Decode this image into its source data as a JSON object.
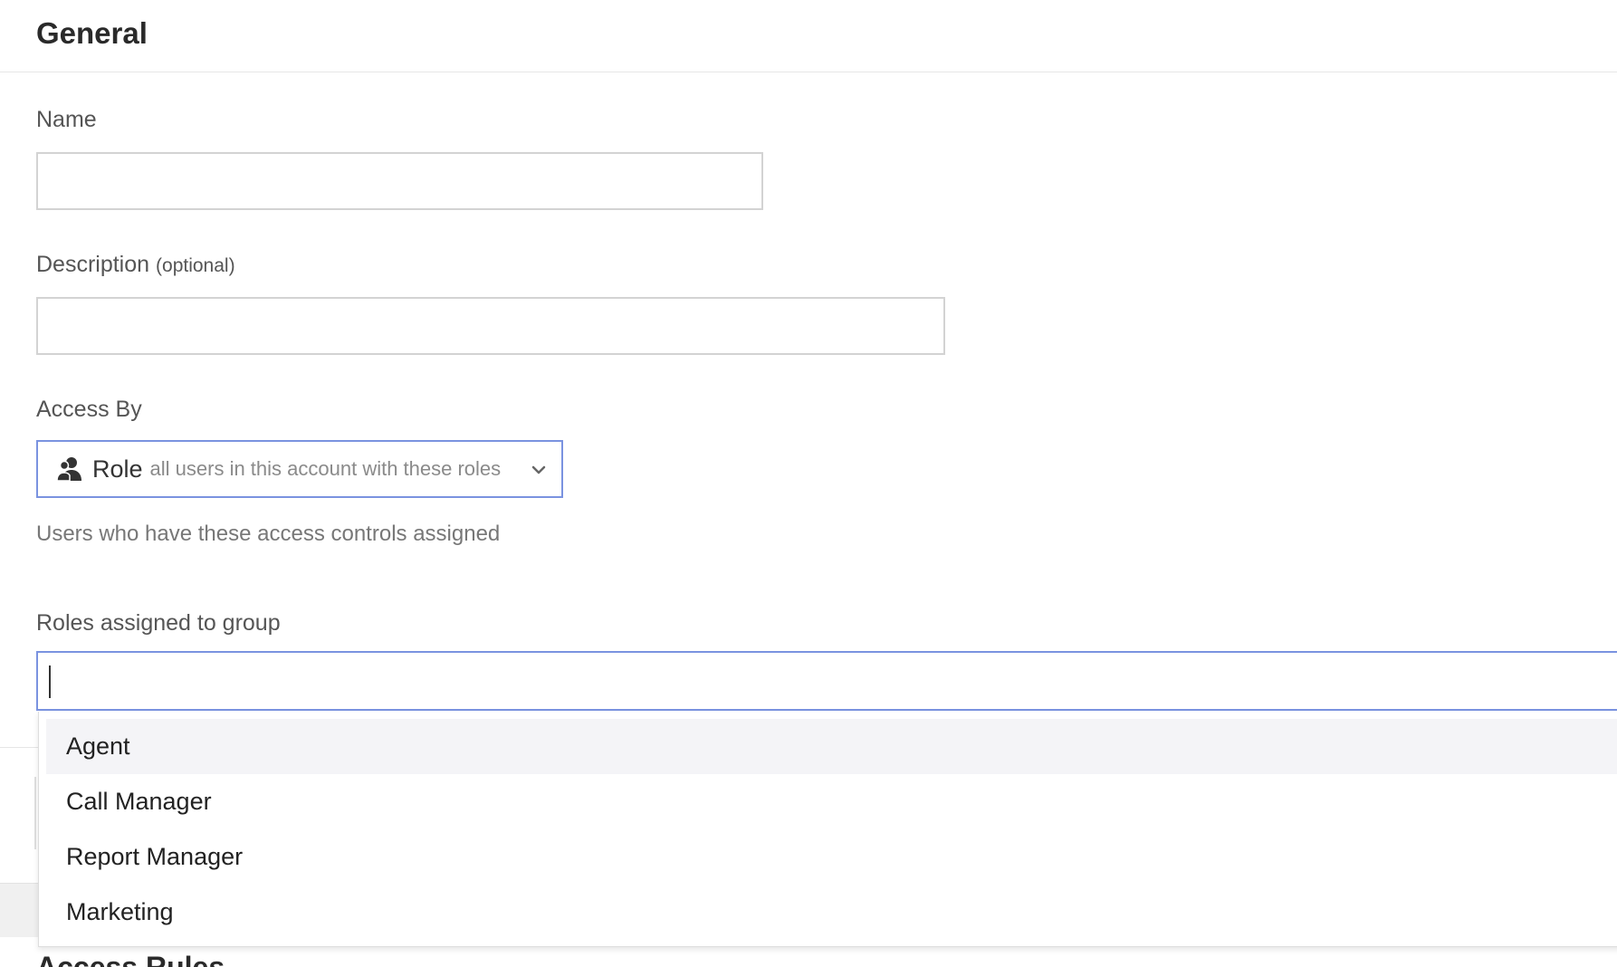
{
  "section": {
    "title": "General"
  },
  "name_field": {
    "label": "Name",
    "value": "",
    "placeholder": ""
  },
  "description_field": {
    "label": "Description",
    "optional": "(optional)",
    "value": "",
    "placeholder": ""
  },
  "access_by": {
    "label": "Access By",
    "selected": "Role",
    "selected_sub": "all users in this account with these roles",
    "icon": "users-icon",
    "help": "Users who have these access controls assigned"
  },
  "roles": {
    "label": "Roles assigned to group",
    "value": "",
    "options": [
      "Agent",
      "Call Manager",
      "Report Manager",
      "Marketing"
    ],
    "highlighted": "Agent"
  },
  "colors": {
    "focus_border": "#7a93e0",
    "input_border": "#d3d3d3",
    "option_highlight": "#f4f4f7"
  }
}
